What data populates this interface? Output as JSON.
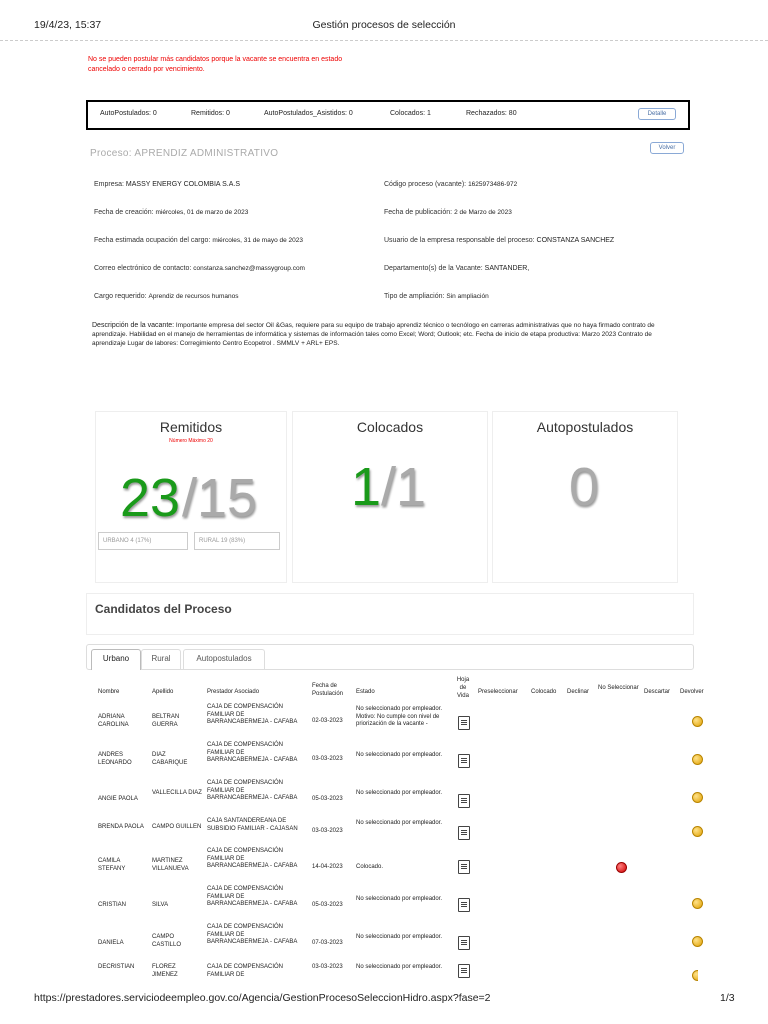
{
  "header": {
    "datetime": "19/4/23, 15:37",
    "title": "Gestión procesos de selección"
  },
  "warning": "No se pueden postular más candidatos porque la vacante se encuentra en estado cancelado o cerrado por vencimiento.",
  "summary": {
    "autopostulados": "AutoPostulados: 0",
    "remitidos": "Remitidos: 0",
    "asistidos": "AutoPostulados_Asistidos: 0",
    "colocados": "Colocados: 1",
    "rechazados": "Rechazados: 80",
    "detalle_btn": "Detalle"
  },
  "process": {
    "volver_btn": "Volver",
    "title": "Proceso: APRENDIZ ADMINISTRATIVO",
    "empresa_label": "Empresa:",
    "empresa": "MASSY ENERGY COLOMBIA S.A.S",
    "codigo_label": "Código proceso (vacante):",
    "codigo": "1625973486-972",
    "creacion_label": "Fecha de creación:",
    "creacion": "miércoles, 01 de marzo de 2023",
    "publicacion_label": "Fecha de publicación:",
    "publicacion": "2 de Marzo de 2023",
    "ocupacion_label": "Fecha estimada ocupación del cargo:",
    "ocupacion": "miércoles, 31 de mayo de 2023",
    "usuario_label": "Usuario de la empresa responsable del proceso:",
    "usuario": "CONSTANZA SANCHEZ",
    "correo_label": "Correo electrónico de contacto:",
    "correo": "constanza.sanchez@massygroup.com",
    "departamento_label": "Departamento(s) de la Vacante:",
    "departamento": "SANTANDER,",
    "cargo_label": "Cargo requerido:",
    "cargo": "Aprendiz de recursos humanos",
    "ampliacion_label": "Tipo de ampliación:",
    "ampliacion": "Sin ampliación",
    "descripcion_label": "Descripción de la vacante:",
    "descripcion": "Importante empresa del sector Oil &Gas, requiere para su equipo de trabajo aprendiz técnico o tecnólogo en carreras administrativas que no haya firmado contrato de aprendizaje. Habilidad en el manejo de herramientas de informática y sistemas de información tales como Excel; Word; Outlook; etc. Fecha de inicio de etapa productiva: Marzo 2023 Contrato de aprendizaje Lugar de labores: Corregimiento Centro Ecopetrol . SMMLV + ARL+ EPS."
  },
  "stats": {
    "remitidos": {
      "title": "Remitidos",
      "sub": "Número Máximo 20",
      "num": "23",
      "den": "/15",
      "urbano": "URBANO 4 (17%)",
      "rural": "RURAL 19 (83%)"
    },
    "colocados": {
      "title": "Colocados",
      "num": "1",
      "den": "/1"
    },
    "autopostulados": {
      "title": "Autopostulados",
      "num": "0"
    }
  },
  "candidatos": {
    "title": "Candidatos del Proceso",
    "tabs": [
      "Urbano",
      "Rural",
      "Autopostulados"
    ],
    "headers": [
      "Nombre",
      "Apellido",
      "Prestador Asociado",
      "Fecha de Postulación",
      "Estado",
      "Hoja de Vida",
      "Preseleccionar",
      "Colocado",
      "Declinar",
      "No Seleccionar",
      "Descartar",
      "Devolver"
    ],
    "rows": [
      {
        "nombre": "ADRIANA CAROLINA",
        "apellido": "BELTRAN GUERRA",
        "prestador": "CAJA DE COMPENSACIÓN FAMILIAR DE BARRANCABERMEJA - CAFABA",
        "fecha": "02-03-2023",
        "estado": "No seleccionado por empleador. Motivo: No cumple con nivel de priorización de la vacante -"
      },
      {
        "nombre": "ANDRES LEONARDO",
        "apellido": "DIAZ CABARIQUE",
        "prestador": "CAJA DE COMPENSACIÓN FAMILIAR DE BARRANCABERMEJA - CAFABA",
        "fecha": "03-03-2023",
        "estado": "No seleccionado por empleador."
      },
      {
        "nombre": "ANGIE PAOLA",
        "apellido": "VALLECILLA DIAZ",
        "prestador": "CAJA DE COMPENSACIÓN FAMILIAR DE BARRANCABERMEJA - CAFABA",
        "fecha": "05-03-2023",
        "estado": "No seleccionado por empleador."
      },
      {
        "nombre": "BRENDA PAOLA",
        "apellido": "CAMPO GUILLEN",
        "prestador": "CAJA SANTANDEREANA DE SUBSIDIO FAMILIAR - CAJASAN",
        "fecha": "03-03-2023",
        "estado": "No seleccionado por empleador."
      },
      {
        "nombre": "CAMILA STEFANY",
        "apellido": "MARTINEZ VILLANUEVA",
        "prestador": "CAJA DE COMPENSACIÓN FAMILIAR DE BARRANCABERMEJA - CAFABA",
        "fecha": "14-04-2023",
        "estado": "Colocado."
      },
      {
        "nombre": "CRISTIAN",
        "apellido": "SILVA",
        "prestador": "CAJA DE COMPENSACIÓN FAMILIAR DE BARRANCABERMEJA - CAFABA",
        "fecha": "05-03-2023",
        "estado": "No seleccionado por empleador."
      },
      {
        "nombre": "DANIELA",
        "apellido": "CAMPO CASTILLO",
        "prestador": "CAJA DE COMPENSACIÓN FAMILIAR DE BARRANCABERMEJA - CAFABA",
        "fecha": "07-03-2023",
        "estado": "No seleccionado por empleador."
      },
      {
        "nombre": "DECRISTIAN",
        "apellido": "FLOREZ JIMENEZ",
        "prestador": "CAJA DE COMPENSACIÓN FAMILIAR DE",
        "fecha": "03-03-2023",
        "estado": "No seleccionado por empleador."
      }
    ]
  },
  "footer": {
    "url": "https://prestadores.serviciodeempleo.gov.co/Agencia/GestionProcesoSeleccionHidro.aspx?fase=2",
    "page": "1/3"
  },
  "colors": {
    "warning": "#e00000",
    "green": "#1a9a1a",
    "gray_num": "#aaaaaa",
    "dot_yellow": "#f0b400",
    "dot_red": "#d00000"
  }
}
